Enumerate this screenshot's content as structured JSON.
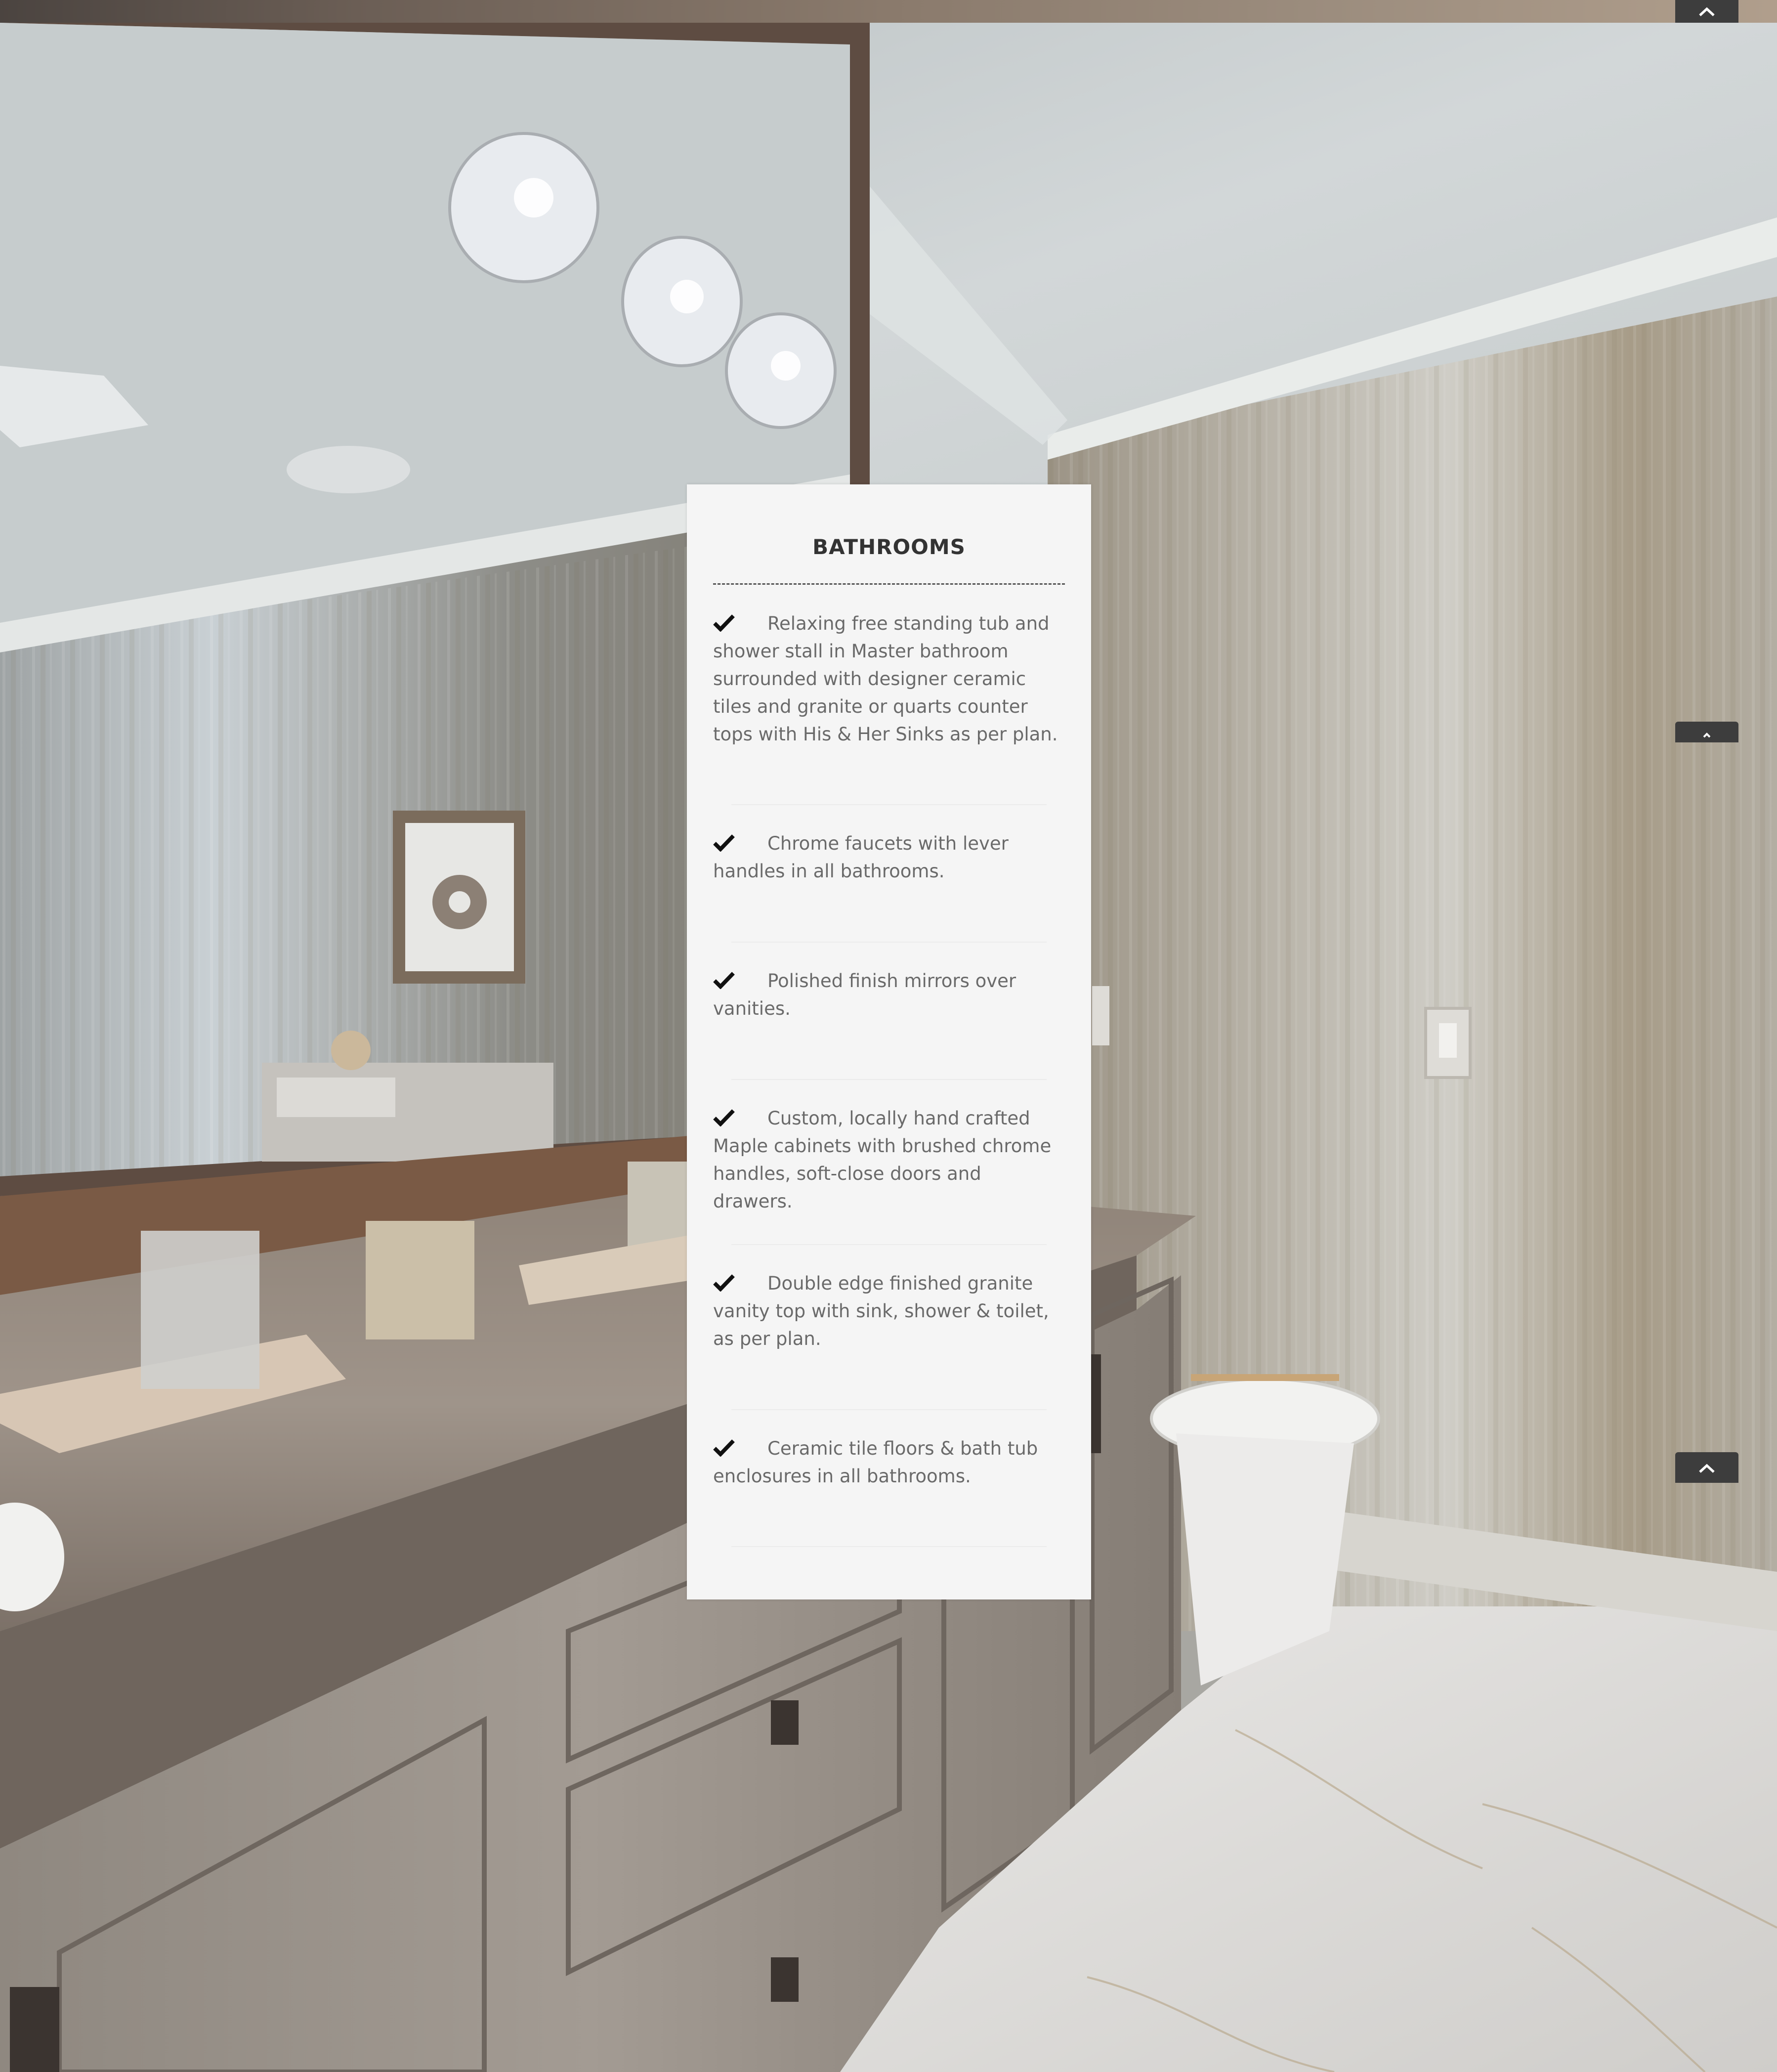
{
  "section": {
    "title": "BATHROOMS"
  },
  "features": [
    {
      "text": "Relaxing free standing tub and shower stall in Master bathroom surrounded with designer ceramic tiles  and granite or quarts counter tops with His & Her Sinks as per plan."
    },
    {
      "text": "Chrome faucets with lever handles in all bathrooms."
    },
    {
      "text": "Polished finish mirrors over vanities."
    },
    {
      "text": "Custom, locally hand crafted Maple cabinets with brushed chrome handles, soft-close doors and drawers."
    },
    {
      "text": "Double edge finished granite vanity top with sink, shower & toilet, as per plan."
    },
    {
      "text": "Ceramic tile floors & bath tub enclosures in all bathrooms."
    }
  ],
  "icons": {
    "check": "check-icon",
    "scroll_top": "chevron-up-icon",
    "background": "bathroom-photo"
  },
  "colors": {
    "card_bg": "#f5f5f5",
    "title": "#333333",
    "text": "#6a6a6a",
    "scroll_button": "#3d3d3d"
  }
}
